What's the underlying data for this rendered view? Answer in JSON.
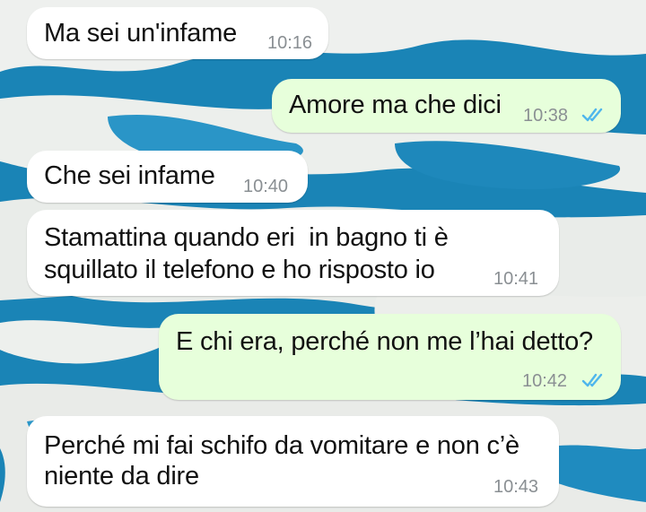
{
  "colors": {
    "incoming_bubble": "#ffffff",
    "outgoing_bubble": "#e7ffdb",
    "read_ticks": "#4fb6ec",
    "timestamp": "#8a8f93"
  },
  "messages": [
    {
      "direction": "incoming",
      "lines": [
        "Ma sei un'infame"
      ],
      "time": "10:16"
    },
    {
      "direction": "outgoing",
      "lines": [
        "Amore ma che dici"
      ],
      "time": "10:38",
      "status": "read"
    },
    {
      "direction": "incoming",
      "lines": [
        "Che sei infame"
      ],
      "time": "10:40"
    },
    {
      "direction": "incoming",
      "lines": [
        "Stamattina quando eri  in bagno ti è",
        "squillato il telefono e ho risposto io"
      ],
      "time": "10:41"
    },
    {
      "direction": "outgoing",
      "lines": [
        "E chi era, perché non me l’hai detto?"
      ],
      "time": "10:42",
      "status": "read"
    },
    {
      "direction": "incoming",
      "lines": [
        "Perché mi fai schifo da vomitare e non c’è",
        "niente da dire"
      ],
      "time": "10:43"
    }
  ]
}
